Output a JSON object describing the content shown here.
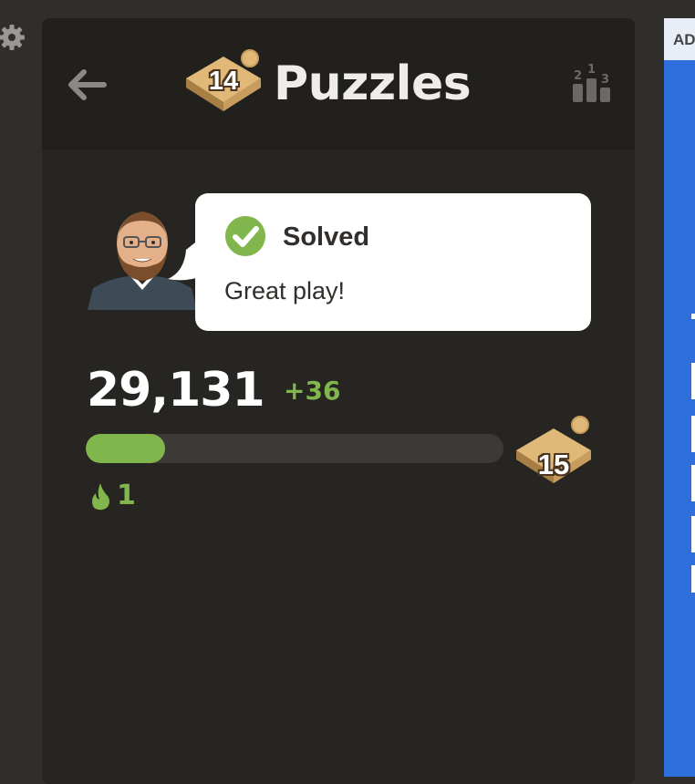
{
  "header": {
    "title": "Puzzles",
    "level_badge": "14"
  },
  "feedback": {
    "status": "Solved",
    "message": "Great play!"
  },
  "rating": {
    "value": "29,131",
    "delta": "+36",
    "progress_fraction": 0.19,
    "next_level_badge": "15"
  },
  "streak": {
    "count": "1"
  },
  "ad_strip": {
    "label": "AD"
  },
  "colors": {
    "accent_green": "#81b64c",
    "panel_bg": "#262522",
    "header_bg": "#21201d",
    "ad_blue": "#2f6fdc"
  },
  "icons": [
    "gear-icon",
    "back-arrow-icon",
    "puzzle-badge-icon",
    "leaderboard-icon",
    "check-icon",
    "flame-icon"
  ]
}
